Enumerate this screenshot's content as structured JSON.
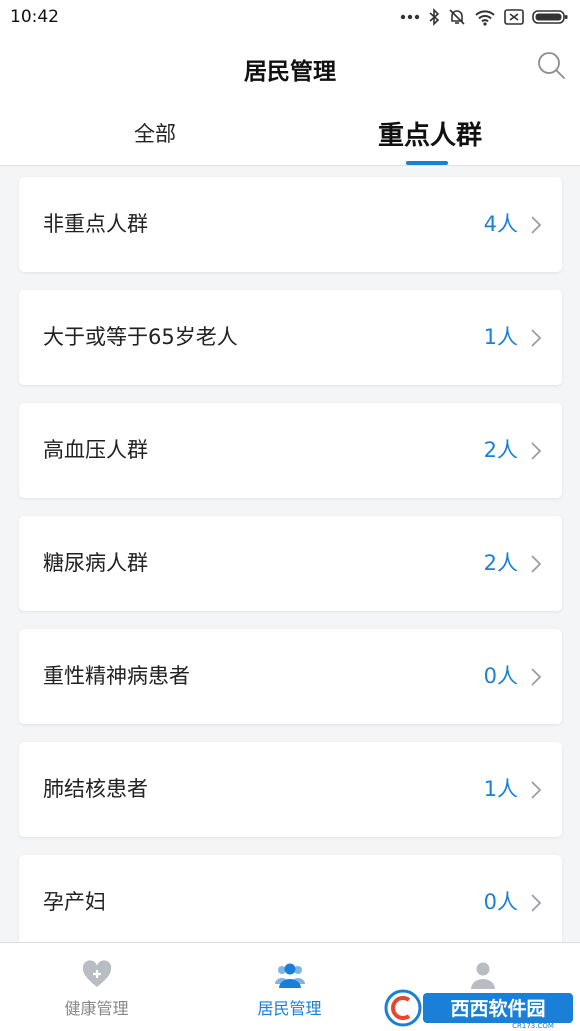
{
  "status_bar": {
    "time": "10:42"
  },
  "header": {
    "title": "居民管理"
  },
  "tabs": [
    {
      "label": "全部",
      "active": false
    },
    {
      "label": "重点人群",
      "active": true
    }
  ],
  "groups": [
    {
      "label": "非重点人群",
      "count": "4人"
    },
    {
      "label": "大于或等于65岁老人",
      "count": "1人"
    },
    {
      "label": "高血压人群",
      "count": "2人"
    },
    {
      "label": "糖尿病人群",
      "count": "2人"
    },
    {
      "label": "重性精神病患者",
      "count": "0人"
    },
    {
      "label": "肺结核患者",
      "count": "1人"
    },
    {
      "label": "孕产妇",
      "count": "0人"
    }
  ],
  "bottom_nav": [
    {
      "label": "健康管理",
      "icon": "heart-plus-icon",
      "active": false
    },
    {
      "label": "居民管理",
      "icon": "people-icon",
      "active": true
    },
    {
      "label": "",
      "icon": "person-icon",
      "active": false
    }
  ],
  "watermark": {
    "text": "西西软件园",
    "sub": "CR173.COM"
  },
  "colors": {
    "accent": "#1a7fd6",
    "background": "#f4f5f7",
    "inactive_icon": "#b9bcc2"
  }
}
